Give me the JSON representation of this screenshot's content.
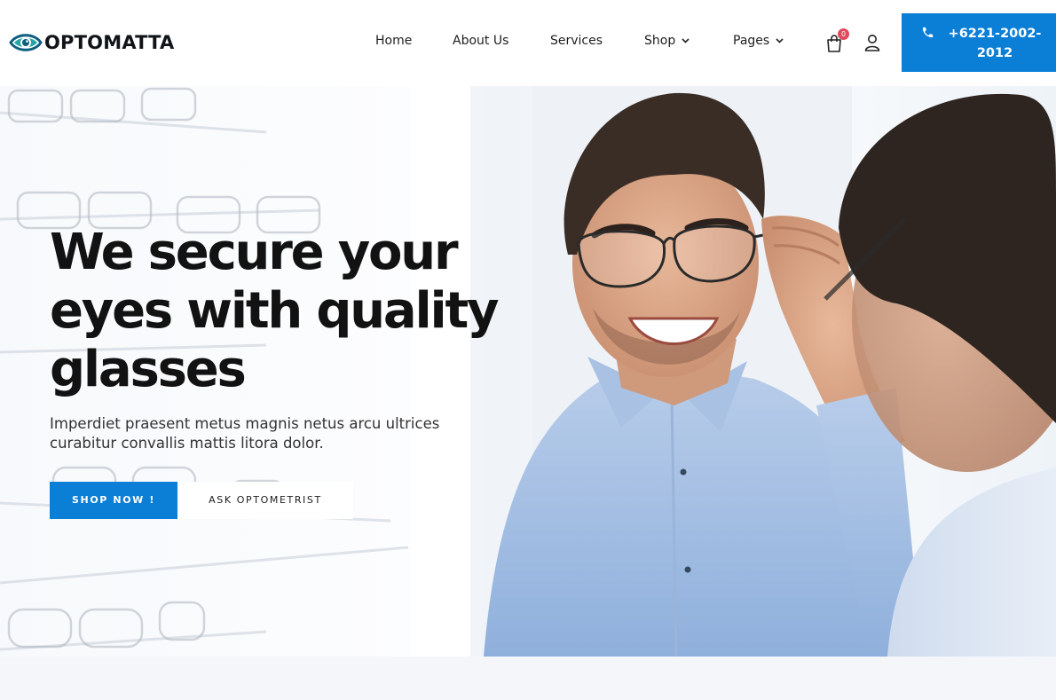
{
  "brand": {
    "name": "OPTOMATTA",
    "icon": "eye-logo-icon",
    "accent": "#0b7fd6"
  },
  "nav": {
    "items": [
      {
        "label": "Home"
      },
      {
        "label": "About Us"
      },
      {
        "label": "Services"
      },
      {
        "label": "Shop",
        "dropdown": true
      },
      {
        "label": "Pages",
        "dropdown": true
      }
    ]
  },
  "cart": {
    "count": "0",
    "icon": "shopping-bag-icon",
    "badge_color": "#e04a5c"
  },
  "account": {
    "icon": "user-icon"
  },
  "phone": {
    "number": "+6221-2002-2012",
    "icon": "phone-icon"
  },
  "hero": {
    "title": "We secure your eyes with quality glasses",
    "subtitle": "Imperdiet praesent metus magnis netus arcu ultrices curabitur convallis mattis litora dolor.",
    "primary_button": "SHOP NOW !",
    "secondary_button": "ASK OPTOMETRIST",
    "image": "smiling-man-trying-glasses-in-mirror"
  }
}
